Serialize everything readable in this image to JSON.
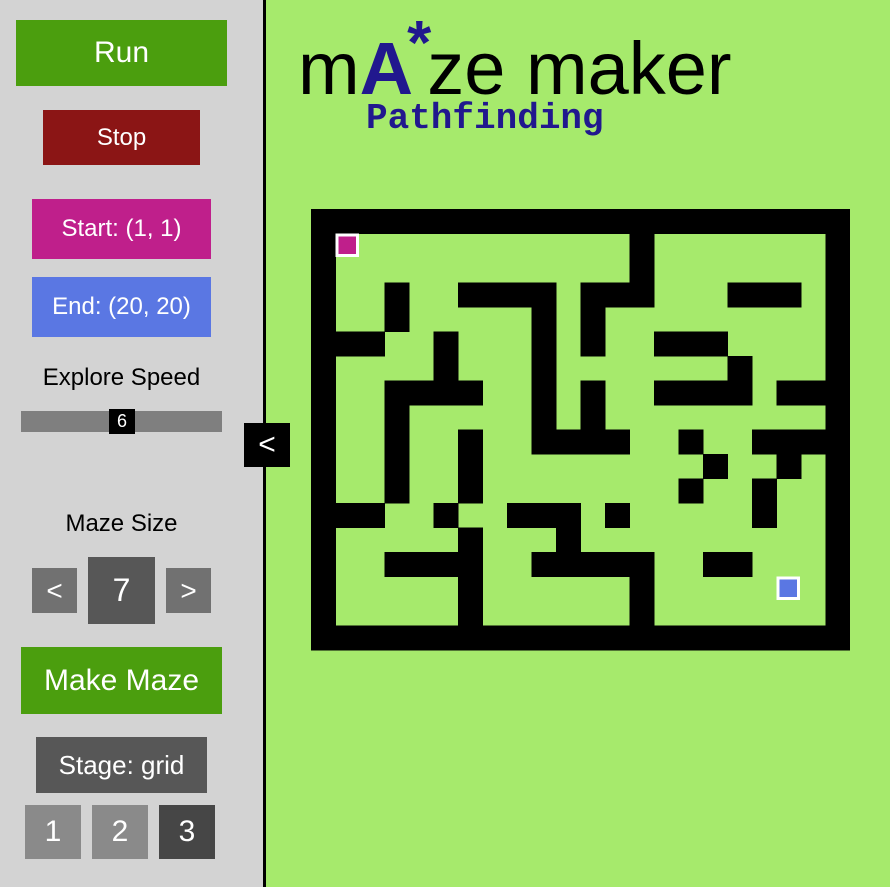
{
  "sidebar": {
    "run_label": "Run",
    "stop_label": "Stop",
    "start_label": "Start: (1, 1)",
    "end_label": "End: (20, 20)",
    "speed_label": "Explore Speed",
    "speed_value": "6",
    "speed_fraction": 0.5,
    "size_label": "Maze Size",
    "size_dec_label": "<",
    "size_value": "7",
    "size_inc_label": ">",
    "make_label": "Make Maze",
    "stage_label": "Stage: grid",
    "stages": [
      "1",
      "2",
      "3"
    ],
    "collapse_label": "<"
  },
  "header": {
    "title_parts": [
      "m",
      "A",
      "*",
      "ze maker"
    ],
    "subtitle": "Pathfinding"
  },
  "colors": {
    "background": "#a6ea6c",
    "sidebar": "#d3d3d3",
    "wall": "#000000",
    "green_button": "#4b9e0e",
    "stop_button": "#8b1515",
    "start_marker": "#bf1f8b",
    "end_marker": "#5a77e3",
    "subtitle": "#21188e"
  },
  "maze": {
    "rows": [
      "######################",
      "#S...........#.......#",
      "#............#.......#",
      "#..#..####.###...###.#",
      "#..#.....#.#.........#",
      "###..#...#.#..###....#",
      "#....#...#.......#...#",
      "#..####..#.#..####.###",
      "#..#.....#.#.........#",
      "#..#..#..####..#..####",
      "#..#..#.........#..#.#",
      "#..#..#........#..#..#",
      "###..#..###.#.....#..#",
      "#.....#...#..........#",
      "#..####..#####..##...#",
      "#.....#......#.....E.#",
      "#.....#......#.......#",
      "######################"
    ]
  }
}
